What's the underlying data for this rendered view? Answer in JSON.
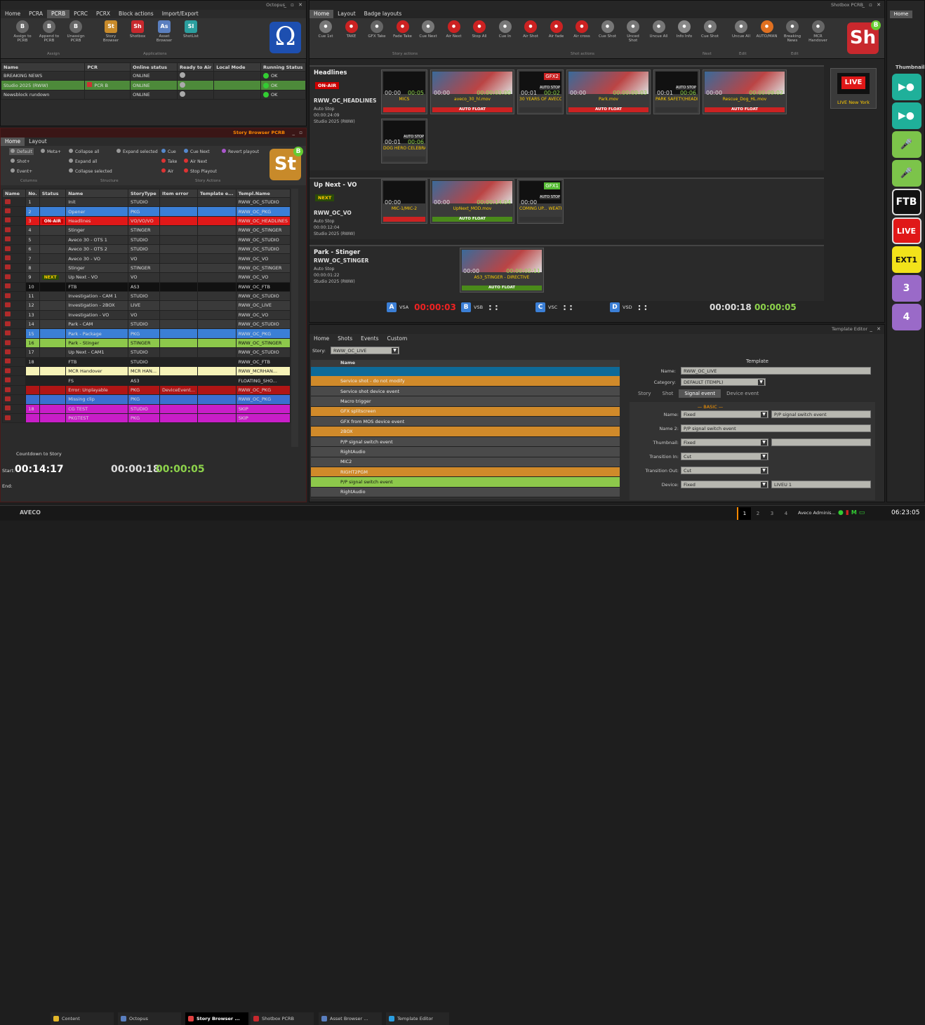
{
  "octopus": {
    "title": "Octopus",
    "menu": [
      "Home",
      "PCRA",
      "PCRB",
      "PCRC",
      "PCRX",
      "Block actions",
      "Import/Export"
    ],
    "ribbon": [
      {
        "label": "Assign to PCRB",
        "icon": "B"
      },
      {
        "label": "Append to PCRB",
        "icon": "B"
      },
      {
        "label": "Unassign PCRB",
        "icon": "B"
      },
      {
        "label": "Story Browser",
        "icon": "St"
      },
      {
        "label": "Shotbox",
        "icon": "Sh"
      },
      {
        "label": "Asset Browser",
        "icon": "As"
      },
      {
        "label": "ShotList",
        "icon": "SI"
      }
    ],
    "groups": [
      "Assign",
      "Applications"
    ],
    "cols": [
      "Name",
      "PCR",
      "Online status",
      "Ready to Air",
      "Local Mode",
      "Running Status"
    ],
    "rows": [
      [
        "BREAKING NEWS",
        "",
        "ONLINE",
        "",
        "",
        "OK"
      ],
      [
        "Studio 2025 (RWW)",
        "PCR B",
        "ONLINE",
        "",
        "",
        "OK"
      ],
      [
        "Newsblock rundown",
        "",
        "ONLINE",
        "",
        "",
        "OK"
      ]
    ]
  },
  "story_browser": {
    "title": "Story Browser PCRB",
    "tabs": [
      "Home",
      "Layout"
    ],
    "actions": [
      "Default",
      "Meta+",
      "Collapse all",
      "Expand selected",
      "Cue",
      "Cue Next",
      "Revert playout",
      "Shot+",
      "Expand all",
      "Take",
      "Air Next",
      "Event+",
      "Collapse selected",
      "Air",
      "Stop Playout"
    ],
    "groups": [
      "Columns",
      "Structure",
      "Story Actions"
    ],
    "cols": [
      "Name",
      "No.",
      "Status",
      "Name",
      "StoryType",
      "Item error",
      "Template e...",
      "Templ.Name"
    ],
    "rows": [
      [
        "1",
        "",
        "Init",
        "STUDIO",
        "",
        "",
        "RWW_OC_STUDIO"
      ],
      [
        "2",
        "",
        "Opener",
        "PKG",
        "",
        "",
        "RWW_OC_PKG"
      ],
      [
        "3",
        "ON-AIR",
        "Headlines",
        "VO/VO/VO",
        "",
        "",
        "RWW_OC_HEADLINES"
      ],
      [
        "4",
        "",
        "Stinger",
        "STINGER",
        "",
        "",
        "RWW_OC_STINGER"
      ],
      [
        "5",
        "",
        "Aveco 30 - OTS 1",
        "STUDIO",
        "",
        "",
        "RWW_OC_STUDIO"
      ],
      [
        "6",
        "",
        "Aveco 30 - OTS 2",
        "STUDIO",
        "",
        "",
        "RWW_OC_STUDIO"
      ],
      [
        "7",
        "",
        "Aveco 30 - VO",
        "VO",
        "",
        "",
        "RWW_OC_VO"
      ],
      [
        "8",
        "",
        "Stinger",
        "STINGER",
        "",
        "",
        "RWW_OC_STINGER"
      ],
      [
        "9",
        "NEXT",
        "Up Next - VO",
        "VO",
        "",
        "",
        "RWW_OC_VO"
      ],
      [
        "10",
        "",
        "FTB",
        "AS3",
        "",
        "",
        "RWW_OC_FTB"
      ],
      [
        "11",
        "",
        "Investigation - CAM 1",
        "STUDIO",
        "",
        "",
        "RWW_OC_STUDIO"
      ],
      [
        "12",
        "",
        "Investigation - 2BOX",
        "LIVE",
        "",
        "",
        "RWW_OC_LIVE"
      ],
      [
        "13",
        "",
        "Investigation - VO",
        "VO",
        "",
        "",
        "RWW_OC_VO"
      ],
      [
        "14",
        "",
        "Park - CAM",
        "STUDIO",
        "",
        "",
        "RWW_OC_STUDIO"
      ],
      [
        "15",
        "",
        "Park - Package",
        "PKG",
        "",
        "",
        "RWW_OC_PKG"
      ],
      [
        "16",
        "",
        "Park - Stinger",
        "STINGER",
        "",
        "",
        "RWW_OC_STINGER"
      ],
      [
        "17",
        "",
        "Up Next - CAM1",
        "STUDIO",
        "",
        "",
        "RWW_OC_STUDIO"
      ],
      [
        "18",
        "",
        "FTB",
        "STUDIO",
        "",
        "",
        "RWW_OC_FTB"
      ],
      [
        "",
        "",
        "MCR Handover",
        "MCR HAN...",
        "",
        "",
        "RWW_MCRHAN..."
      ],
      [
        "",
        "",
        "FS",
        "AS3",
        "",
        "",
        "FLOATING_SHO..."
      ],
      [
        "",
        "",
        "Error: Unplayable",
        "PKG",
        "DeviceEvent...",
        "",
        "RWW_OC_PKG"
      ],
      [
        "",
        "",
        "Missing clip",
        "PKG",
        "",
        "",
        "RWW_OC_PKG"
      ],
      [
        "18",
        "",
        "CG TEST",
        "STUDIO",
        "",
        "",
        "SKIP"
      ],
      [
        "",
        "",
        "PKGTEST",
        "PKG",
        "",
        "",
        "SKIP"
      ]
    ],
    "countdown_label": "Countdown to Story",
    "start_label": "Start:",
    "start": "00:14:17",
    "t1": "00:00:18",
    "t2": "00:00:05",
    "end_label": "End:"
  },
  "shotbox": {
    "title": "Shotbox PCRB",
    "tabs": [
      "Home",
      "Layout",
      "Badge layouts"
    ],
    "ribbon": [
      "Cue 1st",
      "TAKE",
      "GFX Take",
      "Fade Take",
      "Cue Next",
      "Air Next",
      "Stop All",
      "Cue In",
      "Air Shot",
      "Air fade",
      "Air cross",
      "Cue Shot",
      "Unced Shot",
      "Uncue All",
      "Info Info",
      "Cue Shot",
      "Uncue All",
      "AUTO/MAN",
      "Breaking News",
      "MCR Handover"
    ],
    "groups": [
      "Story actions",
      "Shot actions",
      "Next",
      "Edit",
      "Edit"
    ],
    "stories": [
      {
        "title": "Headlines",
        "status": "ON-AIR",
        "template": "RWW_OC_HEADLINES",
        "mode": "Auto Stop",
        "dur": "00:00:24:09",
        "studio": "Studio 2025 (RWW)"
      },
      {
        "title": "Up Next - VO",
        "status": "NEXT",
        "template": "RWW_OC_VO",
        "mode": "Auto Stop",
        "dur": "00:00:12:04",
        "studio": "Studio 2025 (RWW)"
      },
      {
        "title": "Park - Stinger",
        "template": "RWW_OC_STINGER",
        "mode": "Auto Stop",
        "dur": "00:00:01:22",
        "studio": "Studio 2025 (RWW)"
      }
    ],
    "shots1": [
      {
        "name": "MICS",
        "tc1": "00:00",
        "tc2": "00:05",
        "foot": "",
        "kind": "mic"
      },
      {
        "name": "aveco_30_hl.mov",
        "tc1": "00:00",
        "tc2": "00:00:03:00",
        "foot": "AUTO FLOAT",
        "kind": "vo"
      },
      {
        "name": "30 YEARS OF AVECO",
        "tc1": "00:01",
        "tc2": "00:02",
        "foot": "",
        "kind": "gfx",
        "badge": "GFX2"
      },
      {
        "name": "Park.mov",
        "tc1": "00:00",
        "tc2": "00:00:09:03",
        "foot": "AUTO FLOAT",
        "kind": "vo"
      },
      {
        "name": "PARK SAFETY/HEADLINES",
        "tc1": "00:01",
        "tc2": "00:06",
        "foot": "",
        "kind": "gfx"
      },
      {
        "name": "Rescue_Dog_HL.mov",
        "tc1": "00:00",
        "tc2": "00:00:09:02",
        "foot": "AUTO FLOAT",
        "kind": "vo"
      }
    ],
    "shots1b": [
      {
        "name": "DOG HERO CELEBRATED",
        "tc1": "00:01",
        "tc2": "00:06",
        "foot": "",
        "kind": "gfx"
      }
    ],
    "shots2": [
      {
        "name": "MIC-1/MIC-2",
        "tc1": "00:00",
        "tc2": "",
        "foot": "",
        "kind": "mic"
      },
      {
        "name": "UpNext_MOD.mov",
        "tc1": "00:00",
        "tc2": "00:00:14:04",
        "foot": "AUTO FLOAT",
        "kind": "vo"
      },
      {
        "name": "COMING UP... WEATHER",
        "tc1": "00:00",
        "tc2": "",
        "foot": "",
        "kind": "gfx",
        "badge": "GFX1"
      }
    ],
    "shots3": [
      {
        "name": "AS3_STINGER - DIRECTIVE",
        "tc1": "00:00",
        "tc2": "00:00:02:11",
        "foot": "AUTO FLOAT",
        "kind": "vo"
      }
    ],
    "live_label": "LIVE",
    "live_name": "LIVE New York",
    "auto_stop": "AUTO STOP",
    "channels": [
      {
        "id": "A",
        "name": "VSA",
        "time": "00:00:03"
      },
      {
        "id": "B",
        "name": "VSB",
        "time": ": :"
      },
      {
        "id": "C",
        "name": "VSC",
        "time": ": :"
      },
      {
        "id": "D",
        "name": "VSD",
        "time": ": :"
      }
    ],
    "t1": "00:00:18",
    "t2": "00:00:05"
  },
  "thumbnail": {
    "title": "Home",
    "label": "Thumbnail",
    "items": [
      "CAM1",
      "CAM2",
      "MIC1",
      "MIC2",
      "FTB",
      "LIVE",
      "EXT1",
      "3",
      "4"
    ]
  },
  "template_editor": {
    "title": "Template Editor",
    "tabs": [
      "Home",
      "Shots",
      "Events",
      "Custom"
    ],
    "story_label": "Story:",
    "story": "RWW_OC_LIVE",
    "col": "Name",
    "tree": [
      {
        "t": "Service shot - do not modify",
        "lvl": 0
      },
      {
        "t": "Service shot device event",
        "lvl": 1
      },
      {
        "t": "Macro trigger",
        "lvl": 1
      },
      {
        "t": "GFX splitscreen",
        "lvl": 0
      },
      {
        "t": "GFX from MOS device event",
        "lvl": 1
      },
      {
        "t": "2BOX",
        "lvl": 0
      },
      {
        "t": "P/P signal switch event",
        "lvl": 1
      },
      {
        "t": "RightAudio",
        "lvl": 1
      },
      {
        "t": "MIC2",
        "lvl": 1
      },
      {
        "t": "RIGHT2PGM",
        "lvl": 0
      },
      {
        "t": "P/P signal switch event",
        "lvl": 2
      },
      {
        "t": "RightAudio",
        "lvl": 1
      }
    ],
    "heading": "Template",
    "name_label": "Name:",
    "name": "RWW_OC_LIVE",
    "cat_label": "Category:",
    "category": "DEFAULT (TEMPL)",
    "subtabs": [
      "Story",
      "Shot",
      "Signal event",
      "Device event"
    ],
    "basic": "— BASIC —",
    "fields": [
      {
        "l": "Name:",
        "v": "Fixed",
        "v2": "P/P signal switch event"
      },
      {
        "l": "Name 2:",
        "v": "P/P signal switch event",
        "v2": ""
      },
      {
        "l": "Thumbnail:",
        "v": "Fixed",
        "v2": ""
      },
      {
        "l": "Transition In:",
        "v": "Cut",
        "v2": ""
      },
      {
        "l": "Transition Out:",
        "v": "Cut",
        "v2": ""
      },
      {
        "l": "Device:",
        "v": "Fixed",
        "v2": "LIVEU 1"
      }
    ]
  },
  "taskbar": {
    "logo": "AVECO",
    "items": [
      "Content",
      "Octopus",
      "Story Browser ...",
      "Shotbox PCRB",
      "Asset Browser ...",
      "Template Editor"
    ],
    "pages": [
      "1",
      "2",
      "3",
      "4"
    ],
    "user": "Aveco Adminis...",
    "clock": "06:23:05"
  }
}
